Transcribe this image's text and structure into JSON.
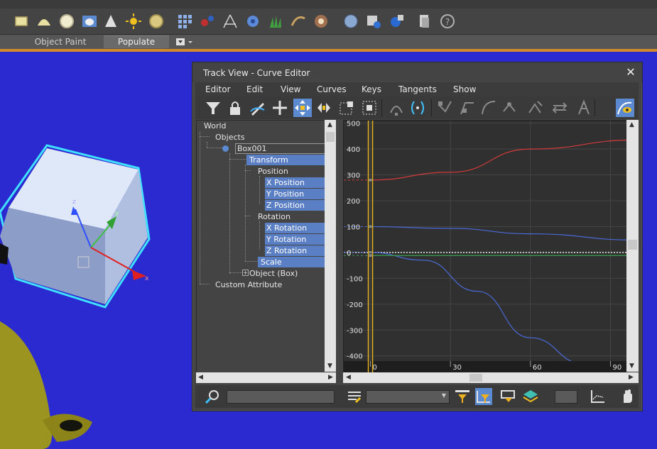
{
  "ribbon": {
    "tabs": [
      {
        "label": "Object Paint"
      },
      {
        "label": "Populate"
      }
    ]
  },
  "window": {
    "title": "Track View - Curve Editor",
    "close_glyph": "✕"
  },
  "menu": [
    "Editor",
    "Edit",
    "View",
    "Curves",
    "Keys",
    "Tangents",
    "Show"
  ],
  "tree": {
    "world": "World",
    "objects": "Objects",
    "box": "Box001",
    "transform": "Transform",
    "position": "Position",
    "x_position": "X Position",
    "y_position": "Y Position",
    "z_position": "Z Position",
    "rotation": "Rotation",
    "x_rotation": "X Rotation",
    "y_rotation": "Y Rotation",
    "z_rotation": "Z Rotation",
    "scale": "Scale",
    "object_box": "Object (Box)",
    "custom_attribute": "Custom Attribute"
  },
  "chart_data": {
    "type": "line",
    "title": "",
    "xlabel": "",
    "ylabel": "",
    "xlim": [
      -10,
      96
    ],
    "ylim": [
      -420,
      510
    ],
    "x_ticks": [
      0,
      30,
      60,
      90
    ],
    "y_ticks": [
      500,
      400,
      300,
      200,
      100,
      0,
      -100,
      -200,
      -300,
      -400
    ],
    "current_frame": 0,
    "grid": true,
    "series": [
      {
        "color": "#d23a3a",
        "points": [
          [
            0,
            280
          ],
          [
            30,
            310
          ],
          [
            60,
            400
          ],
          [
            100,
            435
          ]
        ]
      },
      {
        "color": "#4a6ad8",
        "points": [
          [
            0,
            100
          ],
          [
            30,
            93
          ],
          [
            60,
            72
          ],
          [
            100,
            48
          ]
        ]
      },
      {
        "color": "#4a6ad8",
        "points": [
          [
            0,
            0
          ],
          [
            20,
            -30
          ],
          [
            40,
            -150
          ],
          [
            60,
            -330
          ],
          [
            80,
            -430
          ]
        ]
      },
      {
        "color": "#3aa050",
        "points": [
          [
            0,
            -12
          ],
          [
            100,
            -12
          ]
        ]
      }
    ],
    "colors": {
      "background": "#303030",
      "grid": "#444444",
      "frame_bar": "#e0b020",
      "time_ruler": "#1e1e1e"
    }
  },
  "icons": {
    "top_toolbar": [
      "box-icon",
      "dome-icon",
      "sphere-icon",
      "teapot-icon",
      "cone-icon",
      "sun-icon",
      "sphere-yellow-icon",
      "grid-icon",
      "molecule-icon",
      "tripod-icon",
      "gear-icon",
      "grass-icon",
      "hair-icon",
      "pattern-icon",
      "globe-icon",
      "render-setup-icon",
      "render-icon",
      "document-icon",
      "help-icon"
    ],
    "tv_toolbar": [
      "filter-icon",
      "lock-icon",
      "pencil-icon",
      "add-key-icon",
      "move-keys-icon",
      "slide-keys-icon",
      "scale-keys-icon",
      "scale-values-icon",
      "unlink-icon",
      "cycle-icon",
      "tangent-auto-icon",
      "tangent-custom-icon",
      "tangent-fast-icon",
      "tangent-slow-icon",
      "tangent-step-icon",
      "tangent-linear-icon",
      "tangent-smooth-icon",
      "parameter-curve-icon",
      "show-tangents-icon"
    ],
    "status": [
      "zoom-icon",
      "list-icon",
      "filter-selected-icon",
      "filter-active-icon",
      "frame-icon",
      "layer-icon",
      "graph-icon",
      "pan-icon"
    ]
  }
}
